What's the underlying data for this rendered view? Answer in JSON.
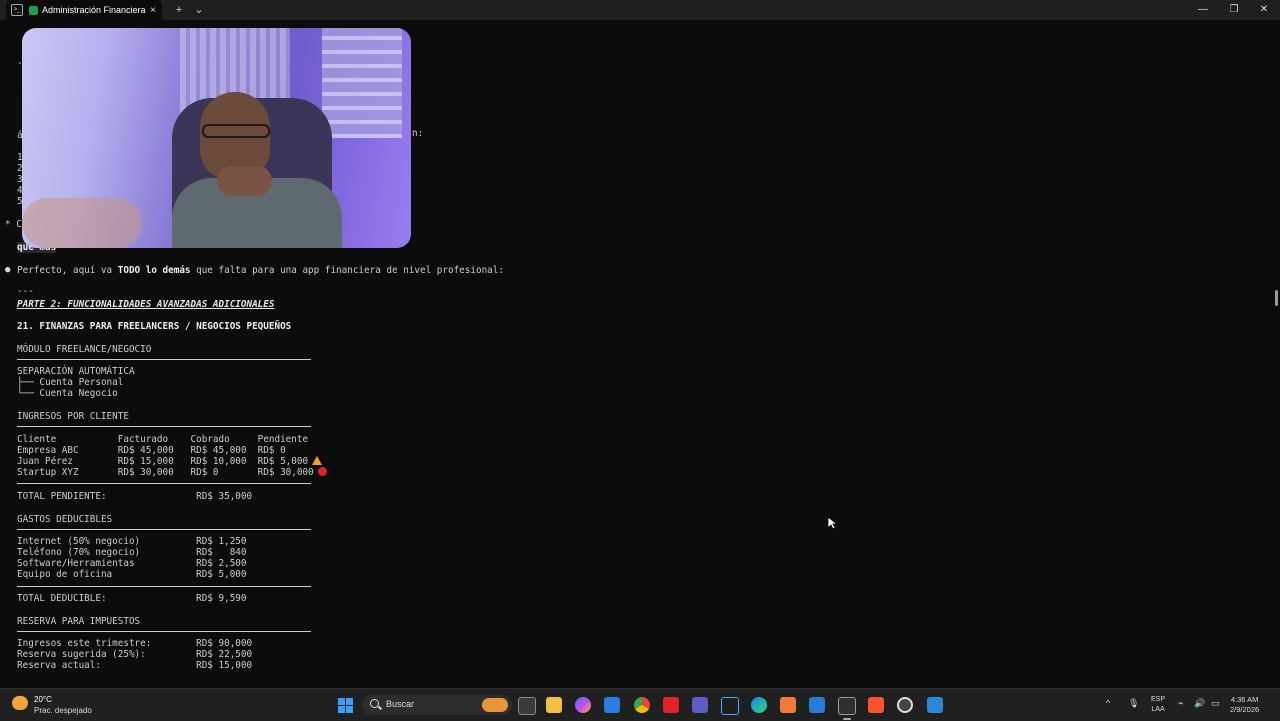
{
  "tab": {
    "title": "Administración Financiera",
    "close_glyph": "×",
    "new_tab_glyph": "+",
    "dropdown_glyph": "⌄"
  },
  "window_controls": {
    "minimize": "—",
    "maximize": "❐",
    "close": "✕"
  },
  "terminal": {
    "partial_visible": {
      "row_left_1": "á",
      "row_left_2": "1",
      "row_left_3": "2",
      "row_left_4": "3",
      "row_left_5": "4",
      "row_left_6": "5",
      "asterisk_c": "* C",
      "right_fragment": "n:",
      "prompt_text": "que más"
    },
    "reply_bullet": "●",
    "reply": {
      "before": "Perfecto, aquí va ",
      "bold": "TODO lo demás",
      "after": " que falta para una app financiera de nivel profesional:"
    },
    "separator": "---",
    "part_heading": "PARTE 2: FUNCIONALIDADES AVANZADAS ADICIONALES",
    "section_heading": "21. FINANZAS PARA FREELANCERS / NEGOCIOS PEQUEÑOS",
    "module_title": "MÓDULO FREELANCE/NEGOCIO",
    "auto_sep": {
      "title": "SEPARACIÓN AUTOMÁTICA",
      "items": [
        "├── Cuenta Personal",
        "└── Cuenta Negocio"
      ]
    },
    "clients": {
      "title": "INGRESOS POR CLIENTE",
      "header": "Cliente           Facturado    Cobrado     Pendiente",
      "rows": [
        {
          "text": "Empresa ABC       RD$ 45,000   RD$ 45,000  RD$ 0",
          "flag": ""
        },
        {
          "text": "Juan Pérez        RD$ 15,000   RD$ 10,000  RD$ 5,000",
          "flag": "warning"
        },
        {
          "text": "Startup XYZ       RD$ 30,000   RD$ 0       RD$ 30,000",
          "flag": "red"
        }
      ],
      "total": "TOTAL PENDIENTE:                RD$ 35,000"
    },
    "deductibles": {
      "title": "GASTOS DEDUCIBLES",
      "rows": [
        "Internet (50% negocio)          RD$ 1,250",
        "Teléfono (70% negocio)          RD$   840",
        "Software/Herramientas           RD$ 2,500",
        "Equipo de oficina               RD$ 5,000"
      ],
      "total": "TOTAL DEDUCIBLE:                RD$ 9,590"
    },
    "taxes": {
      "title": "RESERVA PARA IMPUESTOS",
      "rows": [
        "Ingresos este trimestre:        RD$ 90,000",
        "Reserva sugerida (25%):         RD$ 22,500",
        "Reserva actual:                 RD$ 15,000"
      ]
    }
  },
  "taskbar": {
    "weather": {
      "temp": "20°C",
      "desc": "Prac. despejado"
    },
    "search_placeholder": "Buscar",
    "lang": {
      "line1": "ESP",
      "line2": "LAA"
    },
    "clock": {
      "time": "4:36 AM",
      "date": "2/9/2026"
    },
    "tray_chevron": "^"
  }
}
